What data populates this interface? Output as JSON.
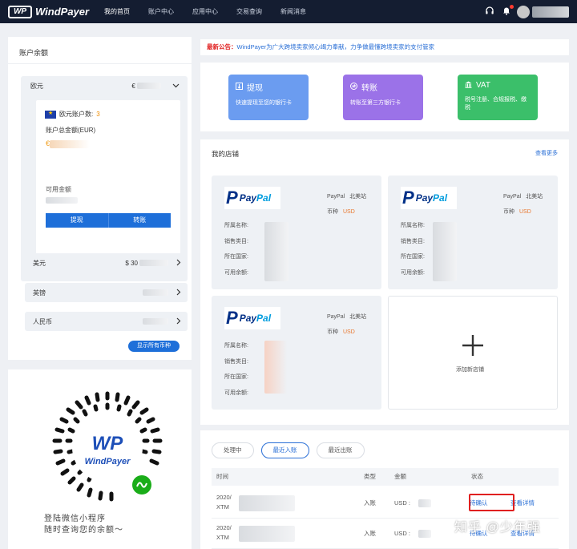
{
  "brand": {
    "name": "WindPayer",
    "mark": "WP"
  },
  "nav": [
    {
      "label": "我的首页",
      "active": true
    },
    {
      "label": "账户中心",
      "active": false
    },
    {
      "label": "应用中心",
      "active": false
    },
    {
      "label": "交易查询",
      "active": false
    },
    {
      "label": "新闻消息",
      "active": false
    }
  ],
  "topbar_icons": [
    "headset-icon",
    "bell-icon"
  ],
  "balance": {
    "title": "账户余额",
    "eur": {
      "name": "欧元",
      "amount_prefix": "€",
      "account_count_label": "欧元账户数:",
      "account_count": "3",
      "total_label": "账户总金额(EUR)",
      "total_prefix": "€",
      "available_label": "可用金额",
      "withdraw_btn": "提现",
      "transfer_btn": "转账"
    },
    "others": [
      {
        "name": "美元",
        "amount": "$ 30"
      },
      {
        "name": "英镑",
        "amount": ""
      },
      {
        "name": "人民币",
        "amount": ""
      }
    ],
    "show_all": "显示所有币种"
  },
  "mini_program": {
    "line1": "登陆微信小程序",
    "line2": "随时查询您的余额～",
    "qr_brand": "WindPayer",
    "qr_mark": "WP"
  },
  "notice": {
    "label": "最新公告：",
    "text": "WindPayer为广大跨境卖家倾心竭力奉献，力争做最懂跨境卖家的支付管家"
  },
  "actions": [
    {
      "title": "提现",
      "icon": "withdraw-icon",
      "desc": "快速提现至您的银行卡",
      "color": "#6b9cf0"
    },
    {
      "title": "转账",
      "icon": "transfer-icon",
      "desc": "转账至第三方银行卡",
      "color": "#9b72e8"
    },
    {
      "title": "VAT",
      "icon": "bank-icon",
      "desc": "税号注册、合规报税、缴税",
      "color": "#3bbf6a"
    }
  ],
  "shops": {
    "title": "我的店铺",
    "more": "查看更多",
    "items": [
      {
        "platform": "PayPal",
        "region": "北美站",
        "currency_label": "币种",
        "currency": "USD"
      },
      {
        "platform": "PayPal",
        "region": "北美站",
        "currency_label": "币种",
        "currency": "USD"
      },
      {
        "platform": "PayPal",
        "region": "北美站",
        "currency_label": "币种",
        "currency": "USD"
      }
    ],
    "field_labels": [
      "所属名称:",
      "销售类目:",
      "所在国家:",
      "可用余额:"
    ],
    "add_label": "添加新店铺"
  },
  "transactions": {
    "tabs": [
      {
        "label": "处理中",
        "active": false
      },
      {
        "label": "最近入账",
        "active": true
      },
      {
        "label": "最近出账",
        "active": false
      }
    ],
    "headers": {
      "time": "时间",
      "type": "类型",
      "amount": "金额",
      "status": "状态"
    },
    "rows": [
      {
        "date": "2020/",
        "ref": "XTM",
        "type": "入账",
        "amount": "USD :",
        "status": "待确认",
        "detail": "查看详情"
      },
      {
        "date": "2020/",
        "ref": "XTM",
        "type": "入账",
        "amount": "USD :",
        "status": "待确认",
        "detail": "查看详情"
      }
    ]
  },
  "watermark": "知乎 @少年强"
}
